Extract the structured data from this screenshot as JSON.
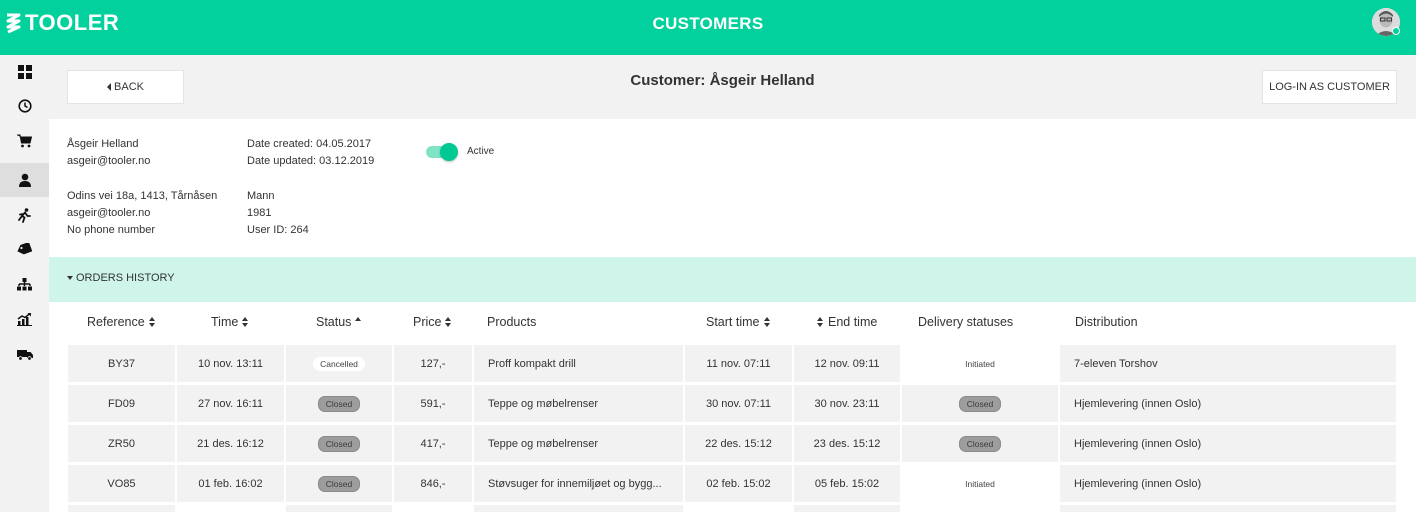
{
  "app": {
    "brand": "TOOLER",
    "page_title": "CUSTOMERS"
  },
  "colors": {
    "accent": "#02d19d",
    "orders_bar": "#cff5ea",
    "row_bg": "#f2f2f2"
  },
  "sidebar": {
    "items": [
      {
        "icon": "dashboard-icon",
        "active": false
      },
      {
        "icon": "clock-icon",
        "active": false
      },
      {
        "icon": "cart-icon",
        "active": false
      },
      {
        "icon": "user-icon",
        "active": true
      },
      {
        "icon": "runner-icon",
        "active": false
      },
      {
        "icon": "tag-icon",
        "active": false
      },
      {
        "icon": "hierarchy-icon",
        "active": false
      },
      {
        "icon": "chart-icon",
        "active": false
      },
      {
        "icon": "truck-icon",
        "active": false
      }
    ]
  },
  "header": {
    "back_label": "BACK",
    "title": "Customer: Åsgeir Helland",
    "login_label": "LOG-IN AS CUSTOMER"
  },
  "customer": {
    "name": "Åsgeir Helland",
    "email": "asgeir@tooler.no",
    "address": "Odins vei 18a, 1413, Tårnåsen",
    "email2": "asgeir@tooler.no",
    "phone": "No phone number",
    "date_created": "Date created: 04.05.2017",
    "date_updated": "Date updated: 03.12.2019",
    "gender": "Mann",
    "birth_year": "1981",
    "user_id": "User ID: 264",
    "active_label": "Active",
    "active": true
  },
  "orders": {
    "title": "ORDERS HISTORY",
    "columns": {
      "reference": "Reference",
      "time": "Time",
      "status": "Status",
      "price": "Price",
      "products": "Products",
      "start_time": "Start time",
      "end_time": "End time",
      "delivery_statuses": "Delivery statuses",
      "distribution": "Distribution"
    },
    "rows": [
      {
        "reference": "BY37",
        "time": "10 nov. 13:11",
        "status": "Cancelled",
        "price": "127,-",
        "products": "Proff kompakt drill",
        "start_time": "11 nov. 07:11",
        "end_time": "12 nov. 09:11",
        "delivery_status": "Initiated",
        "distribution": "7-eleven Torshov"
      },
      {
        "reference": "FD09",
        "time": "27 nov. 16:11",
        "status": "Closed",
        "price": "591,-",
        "products": "Teppe og møbelrenser",
        "start_time": "30 nov. 07:11",
        "end_time": "30 nov. 23:11",
        "delivery_status": "Closed",
        "distribution": "Hjemlevering (innen Oslo)"
      },
      {
        "reference": "ZR50",
        "time": "21 des. 16:12",
        "status": "Closed",
        "price": "417,-",
        "products": "Teppe og møbelrenser",
        "start_time": "22 des. 15:12",
        "end_time": "23 des. 15:12",
        "delivery_status": "Closed",
        "distribution": "Hjemlevering (innen Oslo)"
      },
      {
        "reference": "VO85",
        "time": "01 feb. 16:02",
        "status": "Closed",
        "price": "846,-",
        "products": "Støvsuger for innemiljøet og bygg...",
        "start_time": "02 feb. 15:02",
        "end_time": "05 feb. 15:02",
        "delivery_status": "Initiated",
        "distribution": "Hjemlevering (innen Oslo)"
      }
    ]
  }
}
